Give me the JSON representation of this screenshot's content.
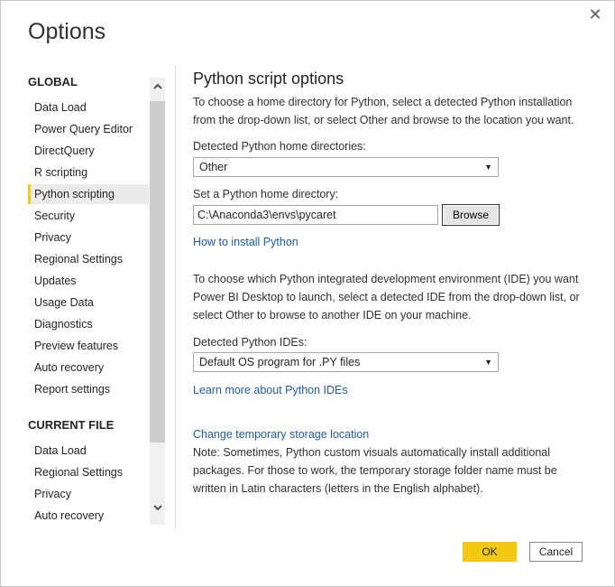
{
  "dialog": {
    "title": "Options",
    "close_glyph": "✕"
  },
  "nav": {
    "global_heading": "GLOBAL",
    "global_items": [
      "Data Load",
      "Power Query Editor",
      "DirectQuery",
      "R scripting",
      "Python scripting",
      "Security",
      "Privacy",
      "Regional Settings",
      "Updates",
      "Usage Data",
      "Diagnostics",
      "Preview features",
      "Auto recovery",
      "Report settings"
    ],
    "active_item": "Python scripting",
    "current_file_heading": "CURRENT FILE",
    "current_file_items": [
      "Data Load",
      "Regional Settings",
      "Privacy",
      "Auto recovery"
    ]
  },
  "icons": {
    "scroll_up": "chevron-up-icon",
    "scroll_down": "chevron-down-icon",
    "dropdown": "caret-down-icon"
  },
  "main": {
    "title": "Python script options",
    "intro": "To choose a home directory for Python, select a detected Python installation from the drop-down list, or select Other and browse to the location you want.",
    "detected_home_label": "Detected Python home directories:",
    "detected_home_value": "Other",
    "set_home_label": "Set a Python home directory:",
    "home_dir_value": "C:\\Anaconda3\\envs\\pycaret",
    "browse_label": "Browse",
    "install_link": "How to install Python",
    "ide_intro": "To choose which Python integrated development environment (IDE) you want Power BI Desktop to launch, select a detected IDE from the drop-down list, or select Other to browse to another IDE on your machine.",
    "detected_ide_label": "Detected Python IDEs:",
    "detected_ide_value": "Default OS program for .PY files",
    "ide_link": "Learn more about Python IDEs",
    "storage_link": "Change temporary storage location",
    "note": "Note: Sometimes, Python custom visuals automatically install additional packages. For those to work, the temporary storage folder name must be written in Latin characters (letters in the English alphabet)."
  },
  "footer": {
    "ok_label": "OK",
    "cancel_label": "Cancel"
  },
  "colors": {
    "accent": "#f2c811",
    "link": "#1f5da2",
    "active_bg": "#ebebeb"
  }
}
